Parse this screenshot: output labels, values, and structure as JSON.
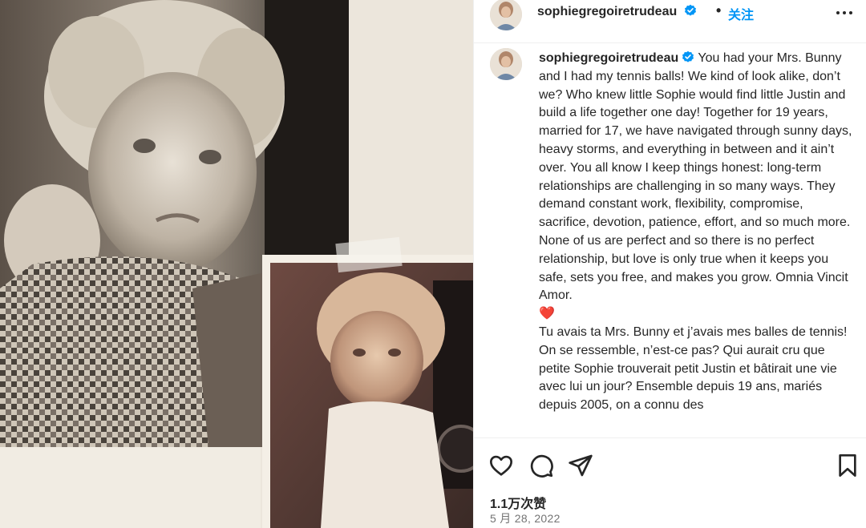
{
  "post": {
    "username": "sophiegregoiretrudeau",
    "follow_label": "关注",
    "separator": "•",
    "verified": true,
    "caption_en": "You had your Mrs. Bunny and I had my tennis balls! We kind of look alike, don’t we? Who knew little Sophie would find little Justin and build a life together one day! Together for 19 years, married for 17, we have navigated through sunny days, heavy storms, and everything in between and it ain’t over. You all know I keep things honest: long-term relationships are challenging in so many ways. They demand constant work, flexibility, compromise, sacrifice, devotion, patience, effort, and so much more. None of us are perfect and so there is no perfect relationship, but love is only true when it keeps you safe, sets you free, and makes you grow. Omnia Vincit Amor.",
    "caption_emoji": "❤️",
    "caption_fr": "Tu avais ta Mrs. Bunny et j’avais mes balles de tennis! On se ressemble, n’est-ce pas? Qui aurait cru que petite Sophie trouverait petit Justin et bâtirait une vie avec lui un jour? Ensemble depuis 19 ans, mariés depuis 2005, on a connu des",
    "likes": "1.1万次赞",
    "date": "5 月 28, 2022"
  },
  "icons": {
    "verified": "verified-badge-icon",
    "more": "more-options-icon",
    "like": "heart-icon",
    "comment": "comment-icon",
    "share": "share-icon",
    "save": "bookmark-icon"
  },
  "colors": {
    "link_blue": "#0095f6",
    "verified_blue": "#0095f6",
    "text": "#262626",
    "secondary": "#737373",
    "heart_red": "#ed4956"
  }
}
